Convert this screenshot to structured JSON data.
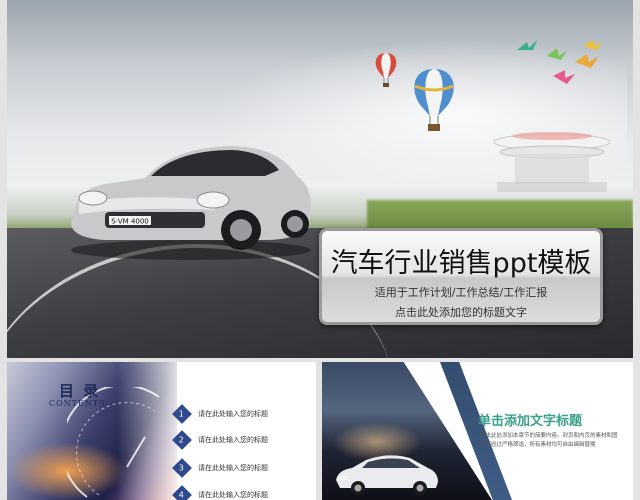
{
  "main_slide": {
    "title": "汽车行业销售ppt模板",
    "subtitle_line1": "适用于工作计划/工作总结/工作汇报",
    "subtitle_line2": "点击此处添加您的标题文字",
    "plate": "S·VM 4000"
  },
  "thumbnails": {
    "toc": {
      "title": "目 录",
      "subtitle": "CONTENTS",
      "items": [
        {
          "num": "1",
          "text": "请在此处输入您的标题"
        },
        {
          "num": "2",
          "text": "请在此处输入您的标题"
        },
        {
          "num": "3",
          "text": "请在此处输入您的标题"
        },
        {
          "num": "4",
          "text": "请在此处输入您的标题"
        }
      ]
    },
    "content": {
      "heading": "单击添加文字标题",
      "body": "单击此处添加本章节的简要内容。封页和内页的素材和图表都经过严格筛选，所有素材均可自由编辑替换"
    }
  },
  "colors": {
    "toc_accent": "#2d4a8c",
    "content_heading": "#3aa08a"
  }
}
